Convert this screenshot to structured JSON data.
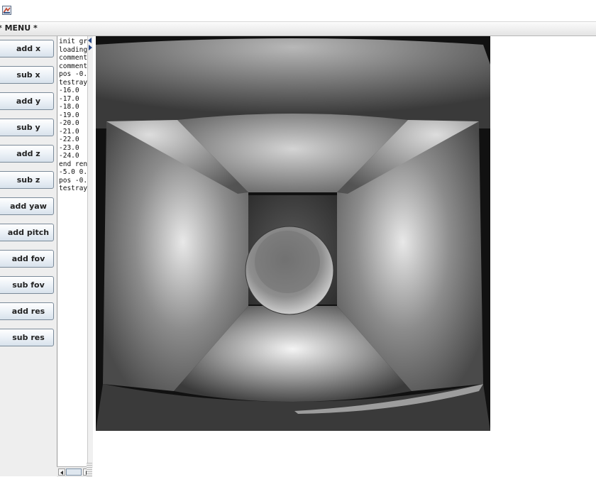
{
  "window": {
    "title": ""
  },
  "menu": {
    "label": "* MENU *"
  },
  "buttons": [
    {
      "label": "add x"
    },
    {
      "label": "sub x"
    },
    {
      "label": "add y"
    },
    {
      "label": "sub y"
    },
    {
      "label": "add z"
    },
    {
      "label": "sub z"
    },
    {
      "label": "add yaw"
    },
    {
      "label": "add pitch"
    },
    {
      "label": "add fov"
    },
    {
      "label": "sub fov"
    },
    {
      "label": "add res"
    },
    {
      "label": "sub res"
    }
  ],
  "log": {
    "lines": [
      "init gr",
      "loading",
      "comment",
      "comment",
      "pos -0.",
      "testray",
      "-16.0",
      "-17.0",
      "-18.0",
      "-19.0",
      "-20.0",
      "-21.0",
      "-22.0",
      "-23.0",
      "-24.0",
      "end ren",
      "-5.0 0.",
      "pos -0.",
      "testray"
    ]
  },
  "icons": {
    "app": "java-app-icon",
    "scroll_up": "arrow-up-icon",
    "scroll_right": "arrow-right-icon"
  },
  "colors": {
    "render_background": "#0f0f0f",
    "button_border": "#7a8a99",
    "panel_background": "#eeeeee"
  }
}
